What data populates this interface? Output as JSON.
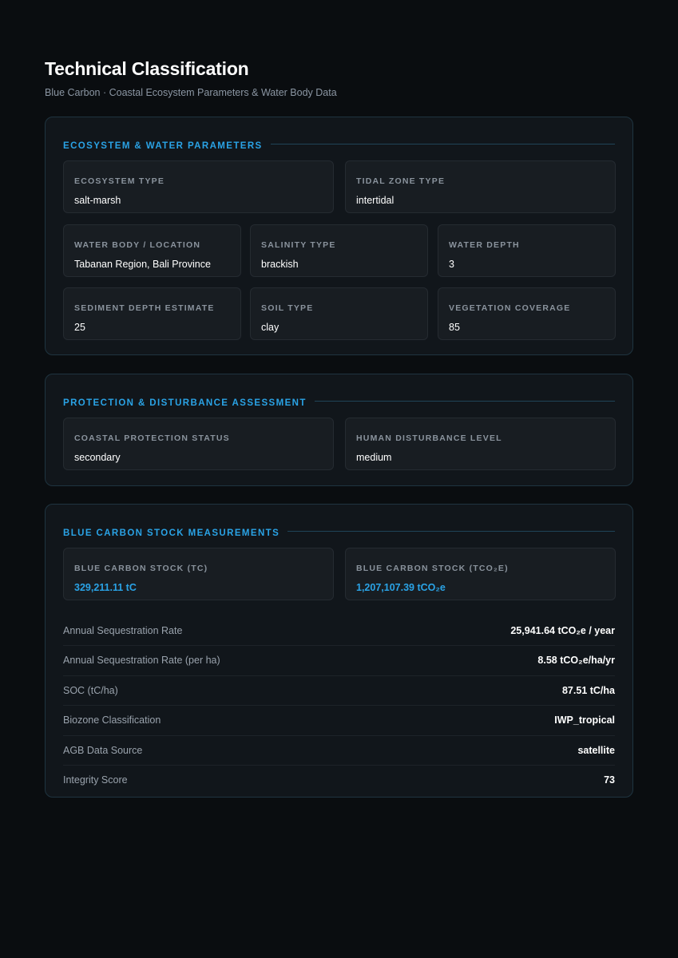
{
  "header": {
    "title": "Technical Classification",
    "subtitle": "Blue Carbon · Coastal Ecosystem Parameters & Water Body Data"
  },
  "ecosystem": {
    "title": "ECOSYSTEM & WATER PARAMETERS",
    "fields": [
      {
        "label": "ECOSYSTEM TYPE",
        "value": "salt-marsh"
      },
      {
        "label": "TIDAL ZONE TYPE",
        "value": "intertidal"
      },
      {
        "label": "WATER BODY / LOCATION",
        "value": "Tabanan Region, Bali Province"
      },
      {
        "label": "SALINITY TYPE",
        "value": "brackish"
      },
      {
        "label": "WATER DEPTH",
        "value": "3"
      },
      {
        "label": "SEDIMENT DEPTH ESTIMATE",
        "value": "25"
      },
      {
        "label": "SOIL TYPE",
        "value": "clay"
      },
      {
        "label": "VEGETATION COVERAGE",
        "value": "85"
      }
    ]
  },
  "protection": {
    "title": "PROTECTION & DISTURBANCE ASSESSMENT",
    "fields": [
      {
        "label": "COASTAL PROTECTION STATUS",
        "value": "secondary"
      },
      {
        "label": "HUMAN DISTURBANCE LEVEL",
        "value": "medium"
      }
    ]
  },
  "carbon": {
    "title": "BLUE CARBON STOCK MEASUREMENTS",
    "stocks": [
      {
        "label": "BLUE CARBON STOCK (TC)",
        "value": "329,211.11 tC"
      },
      {
        "label": "BLUE CARBON STOCK (TCO₂E)",
        "value": "1,207,107.39 tCO₂e"
      }
    ],
    "rows": [
      {
        "label": "Annual Sequestration Rate",
        "value": "25,941.64 tCO₂e / year"
      },
      {
        "label": "Annual Sequestration Rate (per ha)",
        "value": "8.58 tCO₂e/ha/yr"
      },
      {
        "label": "SOC (tC/ha)",
        "value": "87.51 tC/ha"
      },
      {
        "label": "Biozone Classification",
        "value": "IWP_tropical"
      },
      {
        "label": "AGB Data Source",
        "value": "satellite"
      },
      {
        "label": "Integrity Score",
        "value": "73"
      }
    ]
  },
  "colors": {
    "background": "#0a0d10",
    "accent": "#2aa3e6",
    "panel": "#11161b",
    "card": "#181d22"
  }
}
